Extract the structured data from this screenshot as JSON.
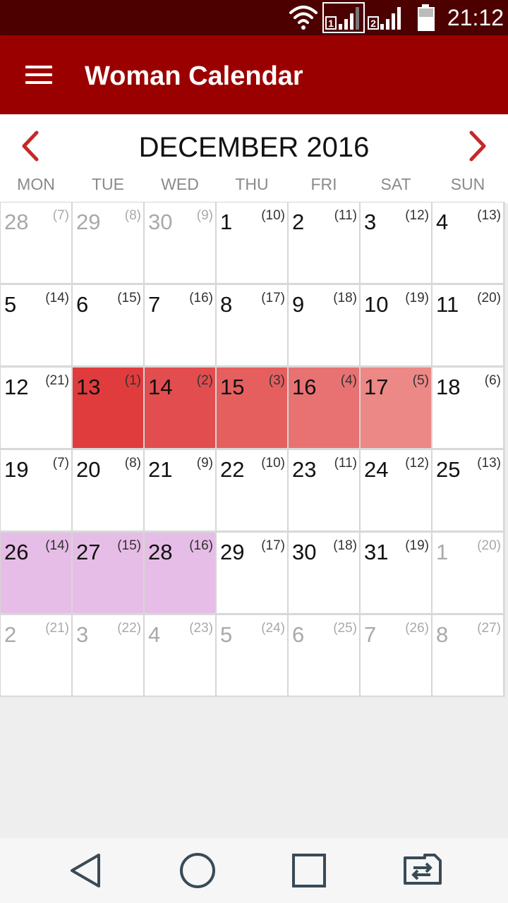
{
  "status_bar": {
    "time": "21:12",
    "sim1": "1",
    "sim2": "2",
    "icons": [
      "wifi-icon",
      "signal-sim1-icon",
      "signal-sim2-icon",
      "battery-icon"
    ]
  },
  "app_bar": {
    "title": "Woman Calendar",
    "menu_icon": "hamburger-icon"
  },
  "calendar": {
    "month_title": "DECEMBER 2016",
    "prev_icon": "chevron-left-icon",
    "next_icon": "chevron-right-icon",
    "weekdays": [
      "MON",
      "TUE",
      "WED",
      "THU",
      "FRI",
      "SAT",
      "SUN"
    ],
    "weeks": [
      [
        {
          "day": "28",
          "cycle": "(7)",
          "other": true
        },
        {
          "day": "29",
          "cycle": "(8)",
          "other": true
        },
        {
          "day": "30",
          "cycle": "(9)",
          "other": true
        },
        {
          "day": "1",
          "cycle": "(10)"
        },
        {
          "day": "2",
          "cycle": "(11)"
        },
        {
          "day": "3",
          "cycle": "(12)"
        },
        {
          "day": "4",
          "cycle": "(13)"
        }
      ],
      [
        {
          "day": "5",
          "cycle": "(14)"
        },
        {
          "day": "6",
          "cycle": "(15)"
        },
        {
          "day": "7",
          "cycle": "(16)"
        },
        {
          "day": "8",
          "cycle": "(17)"
        },
        {
          "day": "9",
          "cycle": "(18)"
        },
        {
          "day": "10",
          "cycle": "(19)"
        },
        {
          "day": "11",
          "cycle": "(20)"
        }
      ],
      [
        {
          "day": "12",
          "cycle": "(21)"
        },
        {
          "day": "13",
          "cycle": "(1)",
          "color": "#e03c3e"
        },
        {
          "day": "14",
          "cycle": "(2)",
          "color": "#e24d4f"
        },
        {
          "day": "15",
          "cycle": "(3)",
          "color": "#e55f5f"
        },
        {
          "day": "16",
          "cycle": "(4)",
          "color": "#e87272"
        },
        {
          "day": "17",
          "cycle": "(5)",
          "color": "#ec8886"
        },
        {
          "day": "18",
          "cycle": "(6)"
        }
      ],
      [
        {
          "day": "19",
          "cycle": "(7)"
        },
        {
          "day": "20",
          "cycle": "(8)"
        },
        {
          "day": "21",
          "cycle": "(9)"
        },
        {
          "day": "22",
          "cycle": "(10)"
        },
        {
          "day": "23",
          "cycle": "(11)"
        },
        {
          "day": "24",
          "cycle": "(12)"
        },
        {
          "day": "25",
          "cycle": "(13)"
        }
      ],
      [
        {
          "day": "26",
          "cycle": "(14)",
          "color": "#e6bde6"
        },
        {
          "day": "27",
          "cycle": "(15)",
          "color": "#e6bde6"
        },
        {
          "day": "28",
          "cycle": "(16)",
          "color": "#e6bde6"
        },
        {
          "day": "29",
          "cycle": "(17)"
        },
        {
          "day": "30",
          "cycle": "(18)"
        },
        {
          "day": "31",
          "cycle": "(19)"
        },
        {
          "day": "1",
          "cycle": "(20)",
          "other": true
        }
      ],
      [
        {
          "day": "2",
          "cycle": "(21)",
          "other": true
        },
        {
          "day": "3",
          "cycle": "(22)",
          "other": true
        },
        {
          "day": "4",
          "cycle": "(23)",
          "other": true
        },
        {
          "day": "5",
          "cycle": "(24)",
          "other": true
        },
        {
          "day": "6",
          "cycle": "(25)",
          "other": true
        },
        {
          "day": "7",
          "cycle": "(26)",
          "other": true
        },
        {
          "day": "8",
          "cycle": "(27)",
          "other": true
        }
      ]
    ]
  },
  "nav_bar": {
    "icons": [
      "back-icon",
      "home-icon",
      "recents-icon",
      "switch-sim-icon"
    ]
  },
  "colors": {
    "status_bar": "#4d0000",
    "app_bar": "#9b0000",
    "accent": "#c62828",
    "period": "#e03c3e",
    "fertile": "#e6bde6"
  }
}
